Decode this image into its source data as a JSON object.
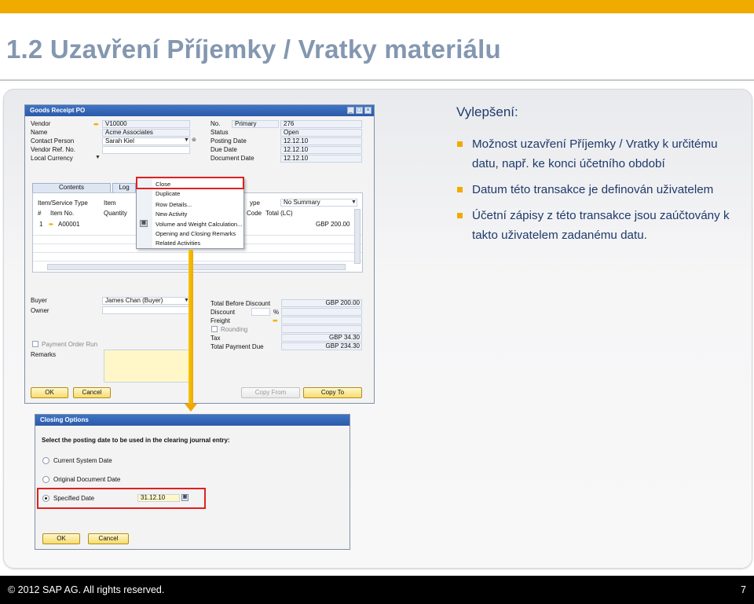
{
  "slide": {
    "title": "1.2 Uzavření Příjemky / Vratky materiálu",
    "footer_copyright": "© 2012 SAP AG. All rights reserved.",
    "page_number": "7"
  },
  "right_panel": {
    "heading": "Vylepšení:",
    "bullets": [
      "Možnost uzavření Příjemky / Vratky k určitému datu, např. ke konci účetního období",
      "Datum této transakce je definován uživatelem",
      "Účetní zápisy z této transakce jsou zaúčtovány k takto uživatelem zadanému datu."
    ]
  },
  "goods_receipt": {
    "window_title": "Goods Receipt PO",
    "header_left": {
      "labels": [
        "Vendor",
        "Name",
        "Contact Person",
        "Vendor Ref. No.",
        "Local Currency"
      ],
      "values": [
        "V10000",
        "Acme Associates",
        "Sarah Kiel",
        "",
        ""
      ]
    },
    "header_right": {
      "labels": [
        "No.",
        "Status",
        "Posting Date",
        "Due Date",
        "Document Date"
      ],
      "no_series": "Primary",
      "values": [
        "276",
        "Open",
        "12.12.10",
        "12.12.10",
        "12.12.10"
      ]
    },
    "tabs": [
      "Contents",
      "Log"
    ],
    "grid": {
      "type_label": "Item/Service Type",
      "type_value": "Item",
      "summary_label": "ype",
      "summary_value": "No Summary",
      "columns": [
        "#",
        "Item No.",
        "Quantity",
        "Code",
        "Total (LC)"
      ],
      "rows": [
        {
          "num": "1",
          "item": "A00001",
          "total": "GBP 200.00"
        }
      ]
    },
    "footer_left": {
      "buyer_label": "Buyer",
      "buyer_value": "James Chan (Buyer)",
      "owner_label": "Owner",
      "payment_label": "Payment Order Run",
      "remarks_label": "Remarks"
    },
    "totals": {
      "labels": [
        "Total Before Discount",
        "Discount",
        "Freight",
        "Rounding",
        "Tax",
        "Total Payment Due"
      ],
      "discount_unit": "%",
      "values": [
        "GBP 200.00",
        "",
        "",
        "",
        "GBP 34.30",
        "GBP 234.30"
      ]
    },
    "buttons": {
      "ok": "OK",
      "cancel": "Cancel",
      "copy_from": "Copy From",
      "copy_to": "Copy To"
    }
  },
  "context_menu": {
    "items": [
      "Close",
      "Duplicate",
      "Row Details...",
      "New Activity",
      "Volume and Weight Calculation...",
      "Opening and Closing Remarks",
      "Related Activities"
    ]
  },
  "closing_options": {
    "title": "Closing Options",
    "prompt": "Select the posting date to be used in the clearing journal entry:",
    "options": [
      "Current System Date",
      "Original Document Date",
      "Specified Date"
    ],
    "selected_index": 2,
    "specified_date": "31.12.10",
    "ok": "OK",
    "cancel": "Cancel"
  },
  "colors": {
    "accent": "#f0ab00",
    "title": "#8497b0",
    "text": "#1e3a6b",
    "highlight_box": "#e02020"
  }
}
